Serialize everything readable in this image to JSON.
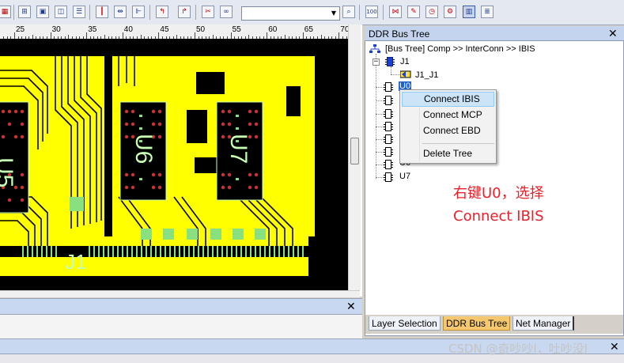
{
  "toolbar": {
    "icons": [
      "grid-icon",
      "add-icon",
      "image-icon",
      "dual-icon",
      "list-icon",
      "marker-icon",
      "split-icon",
      "route-icon",
      "trace-icon",
      "cut-icon",
      "binoculars-icon",
      "find-icon"
    ],
    "combo_value": "",
    "right_icons": [
      "zoom-100-icon",
      "net-icon",
      "edit-icon",
      "clock-icon",
      "gear-icon",
      "active-tool-icon",
      "document-icon"
    ]
  },
  "ruler": {
    "labels": [
      "25",
      "30",
      "35",
      "40",
      "45",
      "50",
      "55",
      "60",
      "65",
      "70"
    ]
  },
  "pcb": {
    "component_labels": [
      "U5",
      "U6",
      "U7",
      "J1"
    ],
    "colors": {
      "board": "#000000",
      "copper": "#ffff00",
      "pads": "#cc3333",
      "text": "#c8ffb4"
    }
  },
  "ddr_panel": {
    "title": "DDR Bus Tree",
    "breadcrumb": "[Bus Tree] Comp >> InterConn >> IBIS",
    "tree": {
      "root_label": "J1",
      "child_label": "J1_J1",
      "selected_label": "U0",
      "visible_items": [
        "U6",
        "U7"
      ]
    }
  },
  "context_menu": {
    "items": [
      "Connect IBIS",
      "Connect MCP",
      "Connect EBD",
      "Delete Tree"
    ],
    "highlighted": "Connect IBIS"
  },
  "annotation": {
    "line1": "右键U0，选择",
    "line2": "Connect IBIS",
    "color": "#e8202a"
  },
  "tabs": [
    {
      "label": "Layer Selection",
      "active": false
    },
    {
      "label": "DDR Bus Tree",
      "active": true
    },
    {
      "label": "Net Manager",
      "active": false
    }
  ],
  "watermark": "CSDN @奇吵吵l，吐吵没l"
}
